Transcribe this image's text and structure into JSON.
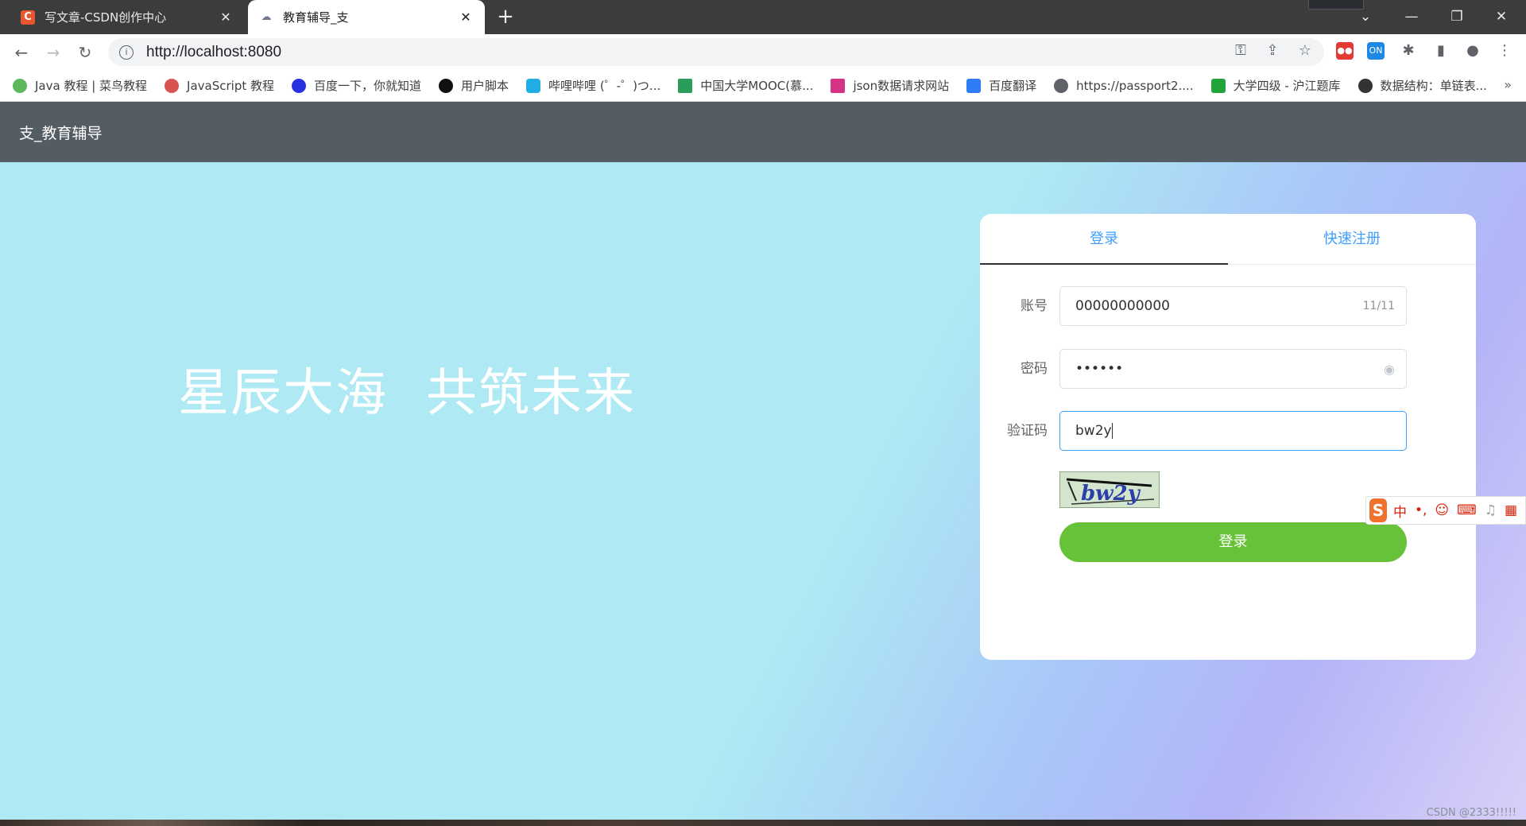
{
  "browser": {
    "tabs": [
      {
        "title": "写文章-CSDN创作中心",
        "favicon": "csdn-icon"
      },
      {
        "title": "教育辅导_支",
        "favicon": "edu-icon"
      }
    ],
    "new_tab_icon": "+",
    "url": "http://localhost:8080",
    "bookmarks": [
      {
        "label": "Java 教程 | 菜鸟教程",
        "color": "#5cb85c"
      },
      {
        "label": "JavaScript 教程",
        "color": "#d9534f"
      },
      {
        "label": "百度一下，你就知道",
        "color": "#2932e1"
      },
      {
        "label": "用户脚本",
        "color": "#111111"
      },
      {
        "label": "哔哩哔哩 (゜-゜)つ...",
        "color": "#23ade5"
      },
      {
        "label": "中国大学MOOC(慕...",
        "color": "#2a9d5c"
      },
      {
        "label": "json数据请求网站",
        "color": "#d63384"
      },
      {
        "label": "百度翻译",
        "color": "#2e7cf6"
      },
      {
        "label": "https://passport2....",
        "color": "#5f6368"
      },
      {
        "label": "大学四级 - 沪江题库",
        "color": "#20a53a"
      },
      {
        "label": "数据结构：单链表...",
        "color": "#333333"
      }
    ],
    "bookmarks_more": "»"
  },
  "site": {
    "header_title": "支_教育辅导",
    "slogan_left": "星辰大海",
    "slogan_right": "共筑未来"
  },
  "login_card": {
    "tab_login": "登录",
    "tab_register": "快速注册",
    "account_label": "账号",
    "account_value": "00000000000",
    "account_count": "11/11",
    "password_label": "密码",
    "password_value": "••••••",
    "captcha_label": "验证码",
    "captcha_value": "bw2y",
    "captcha_image_text": "bw2y",
    "login_button": "登录"
  },
  "ime_toolbar": {
    "logo": "S",
    "mode": "中"
  },
  "watermark": "CSDN @2333!!!!!",
  "colors": {
    "header_bg": "#545c64",
    "accent": "#409eff",
    "login_button": "#67c23a"
  }
}
